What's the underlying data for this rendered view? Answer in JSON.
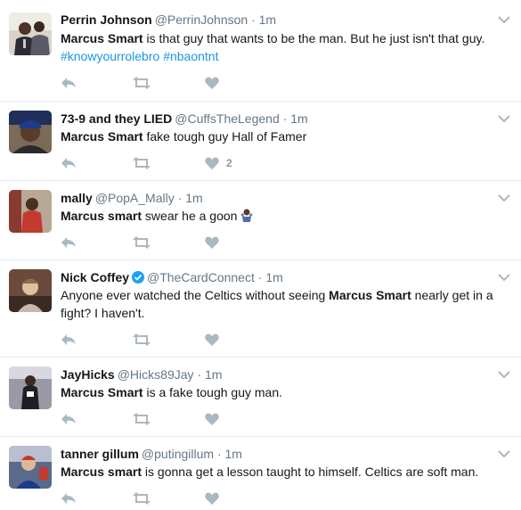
{
  "tweets": [
    {
      "name": "Perrin Johnson",
      "handle": "@PerrinJohnson",
      "dot": "·",
      "time": "1m",
      "segments": [
        {
          "text": "Marcus Smart",
          "style": "bold"
        },
        {
          "text": " is that guy that wants to be the man. But he just isn't that guy. ",
          "style": "plain"
        },
        {
          "text": "#knowyourrolebro",
          "style": "hashtag"
        },
        {
          "text": " ",
          "style": "plain"
        },
        {
          "text": "#nbaontnt",
          "style": "hashtag"
        }
      ],
      "verified": false,
      "like_count": ""
    },
    {
      "name": "73-9 and they LIED",
      "handle": "@CuffsTheLegend",
      "dot": "·",
      "time": "1m",
      "segments": [
        {
          "text": "Marcus Smart",
          "style": "bold"
        },
        {
          "text": " fake tough guy Hall of Famer",
          "style": "plain"
        }
      ],
      "verified": false,
      "like_count": "2"
    },
    {
      "name": "mally",
      "handle": "@PopA_Mally",
      "dot": "·",
      "time": "1m",
      "segments": [
        {
          "text": "Marcus smart",
          "style": "bold"
        },
        {
          "text": " swear he a goon",
          "style": "plain"
        }
      ],
      "emoji": "person-shrugging-emoji",
      "verified": false,
      "like_count": ""
    },
    {
      "name": "Nick Coffey",
      "handle": "@TheCardConnect",
      "dot": "·",
      "time": "1m",
      "segments": [
        {
          "text": "Anyone ever watched the Celtics without seeing ",
          "style": "plain"
        },
        {
          "text": "Marcus Smart",
          "style": "bold"
        },
        {
          "text": " nearly get in a fight? I haven't.",
          "style": "plain"
        }
      ],
      "verified": true,
      "like_count": ""
    },
    {
      "name": "JayHicks",
      "handle": "@Hicks89Jay",
      "dot": "·",
      "time": "1m",
      "segments": [
        {
          "text": "Marcus Smart",
          "style": "bold"
        },
        {
          "text": " is a fake tough guy man.",
          "style": "plain"
        }
      ],
      "verified": false,
      "like_count": ""
    },
    {
      "name": "tanner gillum",
      "handle": "@putingillum",
      "dot": "·",
      "time": "1m",
      "segments": [
        {
          "text": "Marcus smart",
          "style": "bold"
        },
        {
          "text": " is gonna get a lesson taught to himself. Celtics are soft man.",
          "style": "plain"
        }
      ],
      "verified": false,
      "like_count": ""
    }
  ],
  "icons": {
    "reply": "reply-icon",
    "retweet": "retweet-icon",
    "like": "heart-icon",
    "caret": "chevron-down-icon",
    "verified": "verified-badge-icon"
  },
  "colors": {
    "name": "#14171a",
    "meta": "#657786",
    "hashtag": "#1b95e0",
    "action_icon": "#aab8c2",
    "divider": "#e6ecf0",
    "verified": "#1da1f2"
  }
}
